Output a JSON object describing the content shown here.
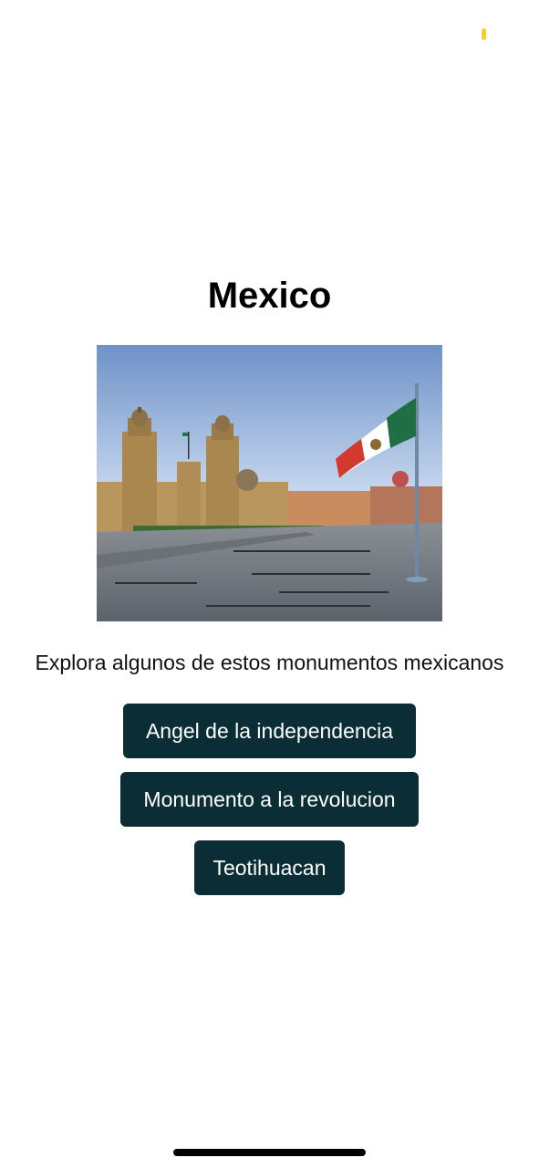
{
  "title": "Mexico",
  "image": {
    "description_icon": "zocalo-mexico-city-photo"
  },
  "subtitle": "Explora algunos de estos monumentos mexicanos",
  "buttons": [
    {
      "label": "Angel de la independencia"
    },
    {
      "label": "Monumento a la revolucion"
    },
    {
      "label": "Teotihuacan"
    }
  ],
  "colors": {
    "button_bg": "#0b2e36",
    "button_text": "#ffffff",
    "status_indicator": "#f7cf2f"
  }
}
